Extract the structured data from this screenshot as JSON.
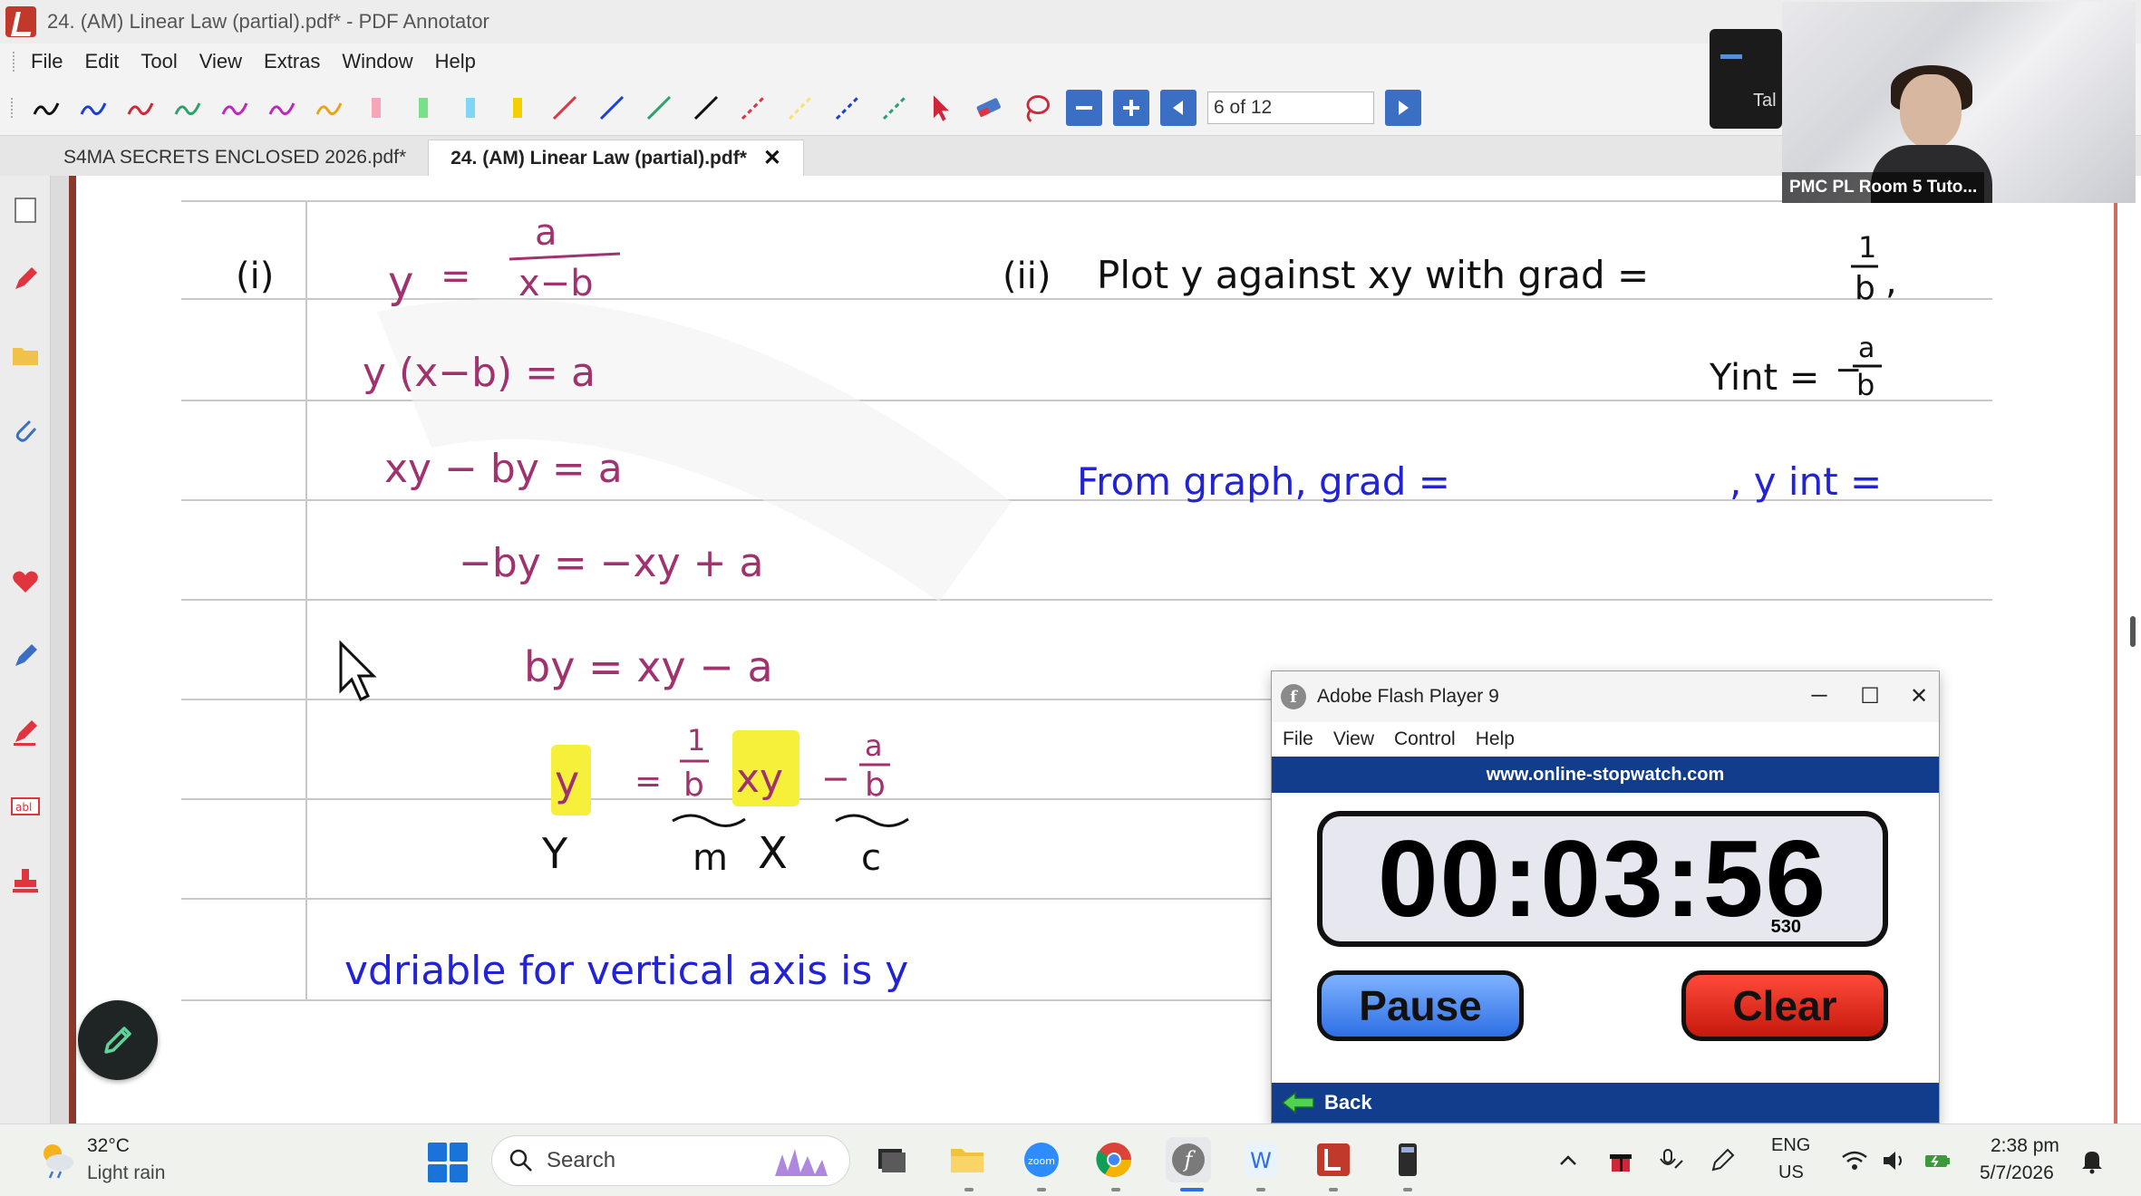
{
  "window": {
    "title": "24. (AM) Linear Law (partial).pdf* - PDF Annotator"
  },
  "menu": [
    "File",
    "Edit",
    "Tool",
    "View",
    "Extras",
    "Window",
    "Help"
  ],
  "toolbar": {
    "page_indicator": "6 of 12",
    "pen_colors": [
      "#111111",
      "#1a3fd8",
      "#d0263a",
      "#2aa36a",
      "#c027c0",
      "#c027c0",
      "#e8a31c"
    ],
    "highlighter_colors": [
      "#f7a6b8",
      "#79e08a",
      "#7fd6f7",
      "#f5d000"
    ],
    "line_colors": [
      "#e0343f",
      "#1a3fd8",
      "#2aa36a",
      "#111111"
    ],
    "dashed_colors": [
      "#e0343f",
      "#f5e56a",
      "#1a3fd8",
      "#2aa36a"
    ]
  },
  "tabs": [
    {
      "label": "S4MA SECRETS ENCLOSED 2026.pdf*",
      "active": false
    },
    {
      "label": "24. (AM) Linear Law (partial).pdf*",
      "active": true
    }
  ],
  "zoom": {
    "participant_name": "PMC PL Room 5 Tuto...",
    "side_label": "Tal"
  },
  "notes": {
    "part_i_label": "(i)",
    "step1_lhs": "y",
    "step1_eq": "=",
    "step1_num": "a",
    "step1_den": "x−b",
    "step2": "y (x−b)  =  a",
    "step3": "xy − by   =  a",
    "step4": "−by   =  −xy  + a",
    "step5": "by   =  xy   − a",
    "step6_y": "y",
    "step6_eq": "=",
    "step6_frac_num": "1",
    "step6_frac_den": "b",
    "step6_xy": "xy",
    "step6_minus": "−",
    "step6_c_num": "a",
    "step6_c_den": "b",
    "label_Y": "Y",
    "label_m": "m",
    "label_X": "X",
    "label_c": "c",
    "variable_line": "vdriable  for  vertical  axis  is  y",
    "part_ii_label": "(ii)",
    "plot_text": "Plot  y  against  xy  with  grad =",
    "grad_num": "1",
    "grad_den": "b",
    "grad_comma": ",",
    "yint_text": "Yint =",
    "yint_sign": "−",
    "yint_num": "a",
    "yint_den": "b",
    "from_graph": "From  graph,  grad =",
    "yint_blank": ", y int ="
  },
  "flash": {
    "title": "Adobe Flash Player 9",
    "menu": [
      "File",
      "View",
      "Control",
      "Help"
    ],
    "site": "www.online-stopwatch.com",
    "timer": "00:03:56",
    "timer_ms": "530",
    "pause_label": "Pause",
    "clear_label": "Clear",
    "back_label": "Back"
  },
  "taskbar": {
    "weather_temp": "32°C",
    "weather_desc": "Light rain",
    "search_placeholder": "Search",
    "lang_line1": "ENG",
    "lang_line2": "US",
    "time": "2:38 pm",
    "date": "5/7/2026"
  },
  "colors": {
    "ink_maroon": "#a0336e",
    "ink_blue": "#2323d6",
    "ink_black": "#111111",
    "highlight": "#f7f03a",
    "flash_blue": "#123c8c"
  }
}
